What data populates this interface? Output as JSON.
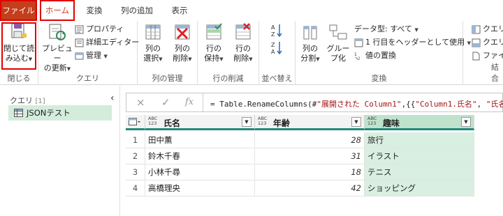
{
  "tabs": {
    "file": "ファイル",
    "home": "ホーム",
    "transform": "変換",
    "add_column": "列の追加",
    "view": "表示"
  },
  "ribbon": {
    "close": {
      "btn_line1": "閉じて読",
      "btn_line2": "み込む",
      "group": "閉じる"
    },
    "query": {
      "preview_line1": "プレビュー",
      "preview_line2": "の更新",
      "properties": "プロパティ",
      "advanced_editor": "詳細エディター",
      "manage": "管理",
      "group": "クエリ"
    },
    "manage_columns": {
      "choose_line1": "列の",
      "choose_line2": "選択",
      "remove_line1": "列の",
      "remove_line2": "削除",
      "group": "列の管理"
    },
    "reduce_rows": {
      "keep_line1": "行の",
      "keep_line2": "保持",
      "remove_line1": "行の",
      "remove_line2": "削除",
      "group": "行の削減"
    },
    "sort": {
      "group": "並べ替え"
    },
    "transform": {
      "split_line1": "列の",
      "split_line2": "分割",
      "group_line1": "グルー",
      "group_line2": "プ化",
      "data_type": "データ型: すべて",
      "first_row_header": "1 行目をヘッダーとして使用",
      "replace_values": "値の置換",
      "group": "変換"
    },
    "combine": {
      "item1": "クエリの",
      "item2": "クエリの",
      "item3": "ファイル",
      "group": "結合"
    }
  },
  "left_pane": {
    "title": "クエリ",
    "count": "[1]",
    "items": [
      {
        "label": "JSONテスト"
      }
    ]
  },
  "formula_bar": {
    "cancel_icon": "×",
    "confirm_icon": "✓",
    "fx": "fx",
    "formula_prefix": "= Table.RenameColumns(#",
    "formula_str1": "\"展開された Column1\"",
    "formula_mid": ",{{",
    "formula_str2": "\"Column1.氏名\"",
    "formula_mid2": ", ",
    "formula_str3": "\"氏名"
  },
  "table": {
    "columns": [
      {
        "type_line1": "ABC",
        "type_line2": "123",
        "name": "氏名"
      },
      {
        "type_line1": "ABC",
        "type_line2": "123",
        "name": "年齢"
      },
      {
        "type_line1": "ABC",
        "type_line2": "123",
        "name": "趣味"
      }
    ],
    "rows": [
      {
        "index": "1",
        "name": "田中薫",
        "age": "28",
        "hobby": "旅行"
      },
      {
        "index": "2",
        "name": "鈴木千春",
        "age": "31",
        "hobby": "イラスト"
      },
      {
        "index": "3",
        "name": "小林千尋",
        "age": "18",
        "hobby": "テニス"
      },
      {
        "index": "4",
        "name": "高橋理央",
        "age": "42",
        "hobby": "ショッピング"
      }
    ]
  },
  "colors": {
    "file_tab": "#c43e1c",
    "highlight_box": "#e00000",
    "column_accent": "#1f8a7a",
    "selected_column": "#d9efe1"
  }
}
